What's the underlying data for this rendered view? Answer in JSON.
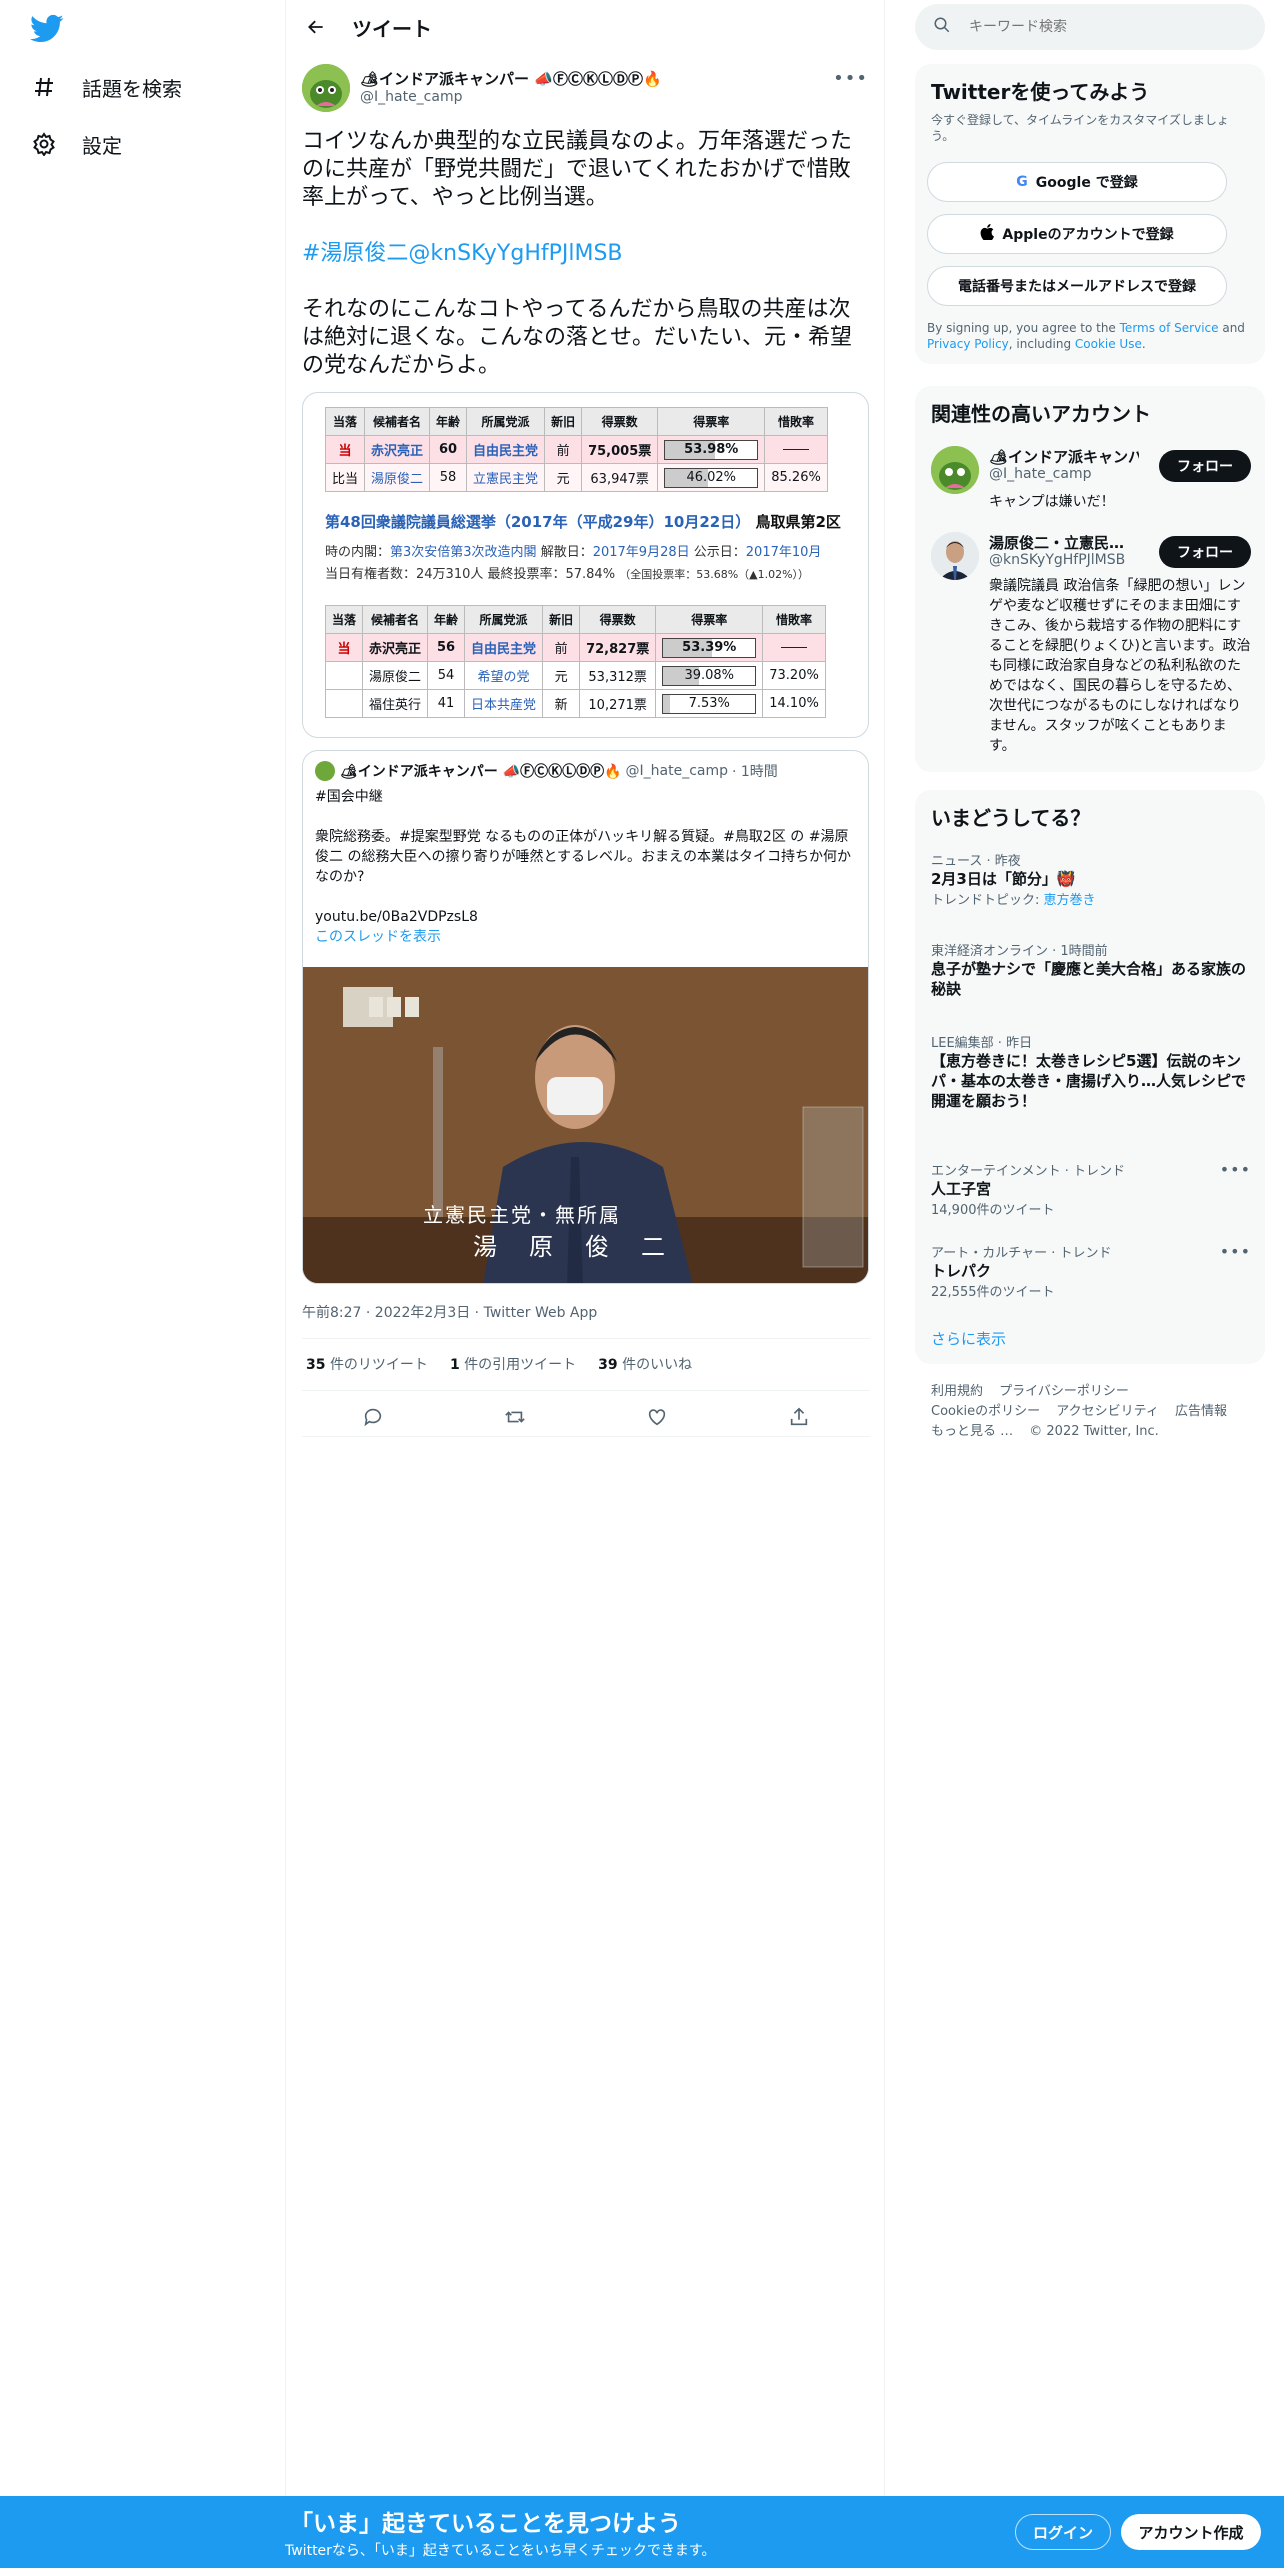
{
  "nav": {
    "explore_label": "話題を検索",
    "settings_label": "設定"
  },
  "header": {
    "title": "ツイート"
  },
  "tweet": {
    "author_name": "🏕インドア派キャンパー 📣ⒻⒸⓀⓁⒹⓅ🔥",
    "author_handle": "@I_hate_camp",
    "text_1": "コイツなんか典型的な立民議員なのよ。万年落選だったのに共産が「野党共闘だ」で退いてくれたおかげで惜敗率上がって、やっと比例当選。",
    "text_2": "#湯原俊二@knSKyYgHfPJlMSB",
    "text_3": "それなのにこんなコトやってるんだから鳥取の共産は次は絶対に退くな。こんなの落とせ。だいたい、元・希望の党なんだからよ。",
    "timestamp": "午前8:27 · 2022年2月3日 · Twitter Web App",
    "retweets_count": "35",
    "retweets_label": "件のリツイート",
    "quotes_count": "1",
    "quotes_label": "件の引用ツイート",
    "likes_count": "39",
    "likes_label": "件のいいね"
  },
  "election_image": {
    "headers": [
      "当落",
      "候補者名",
      "年齢",
      "所属党派",
      "新旧",
      "得票数",
      "得票率",
      "惜敗率"
    ],
    "table1": [
      {
        "result": "当",
        "name": "赤沢亮正",
        "age": "60",
        "party": "自由民主党",
        "status": "前",
        "votes": "75,005票",
        "rate": "53.98%",
        "rate_val": 53.98,
        "ratio": "――"
      },
      {
        "result": "比当",
        "name": "湯原俊二",
        "age": "58",
        "party": "立憲民主党",
        "status": "元",
        "votes": "63,947票",
        "rate": "46.02%",
        "rate_val": 46.02,
        "ratio": "85.26%"
      }
    ],
    "title": "第48回衆議院議員総選挙（2017年（平成29年）10月22日）",
    "district": "鳥取県第2区",
    "info1_label": "時の内閣：",
    "info1_cabinet": "第3次安倍第3次改造内閣",
    "info1_dissolve_label": "解散日：",
    "info1_dissolve": "2017年9月28日",
    "info1_announce_label": "公示日：",
    "info1_announce": "2017年10月",
    "info2": "当日有権者数：24万310人 最終投票率：57.84%",
    "info2_small": "（全国投票率：53.68%（▲1.02%））",
    "table2": [
      {
        "result": "当",
        "name": "赤沢亮正",
        "age": "56",
        "party": "自由民主党",
        "status": "前",
        "votes": "72,827票",
        "rate": "53.39%",
        "rate_val": 53.39,
        "ratio": "――"
      },
      {
        "result": "",
        "name": "湯原俊二",
        "age": "54",
        "party": "希望の党",
        "status": "元",
        "votes": "53,312票",
        "rate": "39.08%",
        "rate_val": 39.08,
        "ratio": "73.20%"
      },
      {
        "result": "",
        "name": "福住英行",
        "age": "41",
        "party": "日本共産党",
        "status": "新",
        "votes": "10,271票",
        "rate": "7.53%",
        "rate_val": 7.53,
        "ratio": "14.10%"
      }
    ]
  },
  "quote": {
    "author_name": "🏕インドア派キャンパー 📣ⒻⒸⓀⓁⒹⓅ🔥",
    "author_handle": "@I_hate_camp",
    "time": "· 1時間",
    "hashtag": "#国会中継",
    "text": "衆院総務委。#提案型野党 なるものの正体がハッキリ解る質疑。#鳥取2区 の #湯原俊二 の総務大臣への擦り寄りが唾然とするレベル。おまえの本業はタイコ持ちか何かなのか?",
    "link": "youtu.be/0Ba2VDPzsL8",
    "thread": "このスレッドを表示",
    "caption_party": "立憲民主党・無所属",
    "caption_name": "湯　原　俊　二"
  },
  "right": {
    "search_placeholder": "キーワード検索",
    "signup_title": "Twitterを使ってみよう",
    "signup_sub": "今すぐ登録して、タイムラインをカスタマイズしましょう。",
    "google_btn": "Google で登録",
    "apple_btn": "Appleのアカウントで登録",
    "phone_btn": "電話番号またはメールアドレスで登録",
    "terms_1": "By signing up, you agree to the ",
    "terms_tos": "Terms of Service",
    "terms_2": " and ",
    "terms_privacy": "Privacy Policy",
    "terms_3": ", including ",
    "terms_cookie": "Cookie Use",
    "terms_4": ".",
    "related_title": "関連性の高いアカウント",
    "related": [
      {
        "name": "🏕インドア派キャンパー…",
        "handle": "@I_hate_camp",
        "bio": "キャンプは嫌いだ！",
        "follow": "フォロー"
      },
      {
        "name": "湯原俊二・立憲民…",
        "handle": "@knSKyYgHfPJlMSB",
        "bio": "衆議院議員 政治信条「緑肥の想い」レンゲや麦など収穫せずにそのまま田畑にすきこみ、後から栽培する作物の肥料にすることを緑肥(りょくひ)と言います。政治も同様に政治家自身などの私利私欲のためではなく、国民の暮らしを守るため、次世代につながるものにしなければなりません。スタッフが呟くこともあります。",
        "follow": "フォロー"
      }
    ],
    "trends_title": "いまどうしてる？",
    "trends": [
      {
        "sub": "ニュース · 昨夜",
        "title": "2月3日は「節分」👹",
        "extra": "トレンドトピック: ",
        "extra_link": "恵方巻き"
      },
      {
        "sub": "東洋経済オンライン · 1時間前",
        "title": "息子が塾ナシで「慶應と美大合格」ある家族の秘訣"
      },
      {
        "sub": "LEE編集部 · 昨日",
        "title": "【恵方巻きに！太巻きレシピ5選】伝説のキンパ・基本の太巻き・唐揚げ入り…人気レシピで開運を願おう！"
      },
      {
        "sub": "エンターテインメント · トレンド",
        "title": "人工子宮",
        "extra": "14,900件のツイート"
      },
      {
        "sub": "アート・カルチャー · トレンド",
        "title": "トレパク",
        "extra": "22,555件のツイート"
      }
    ],
    "show_more": "さらに表示",
    "footer": [
      "利用規約",
      "プライバシーポリシー",
      "Cookieのポリシー",
      "アクセシビリティ",
      "広告情報",
      "もっと見る …",
      "© 2022 Twitter, Inc."
    ]
  },
  "bottombar": {
    "headline": "「いま」起きていることを見つけよう",
    "sub": "Twitterなら、「いま」起きていることをいち早くチェックできます。",
    "login": "ログイン",
    "signup": "アカウント作成"
  },
  "colors": {
    "accent": "#1d9bf0",
    "text": "#0f1419",
    "muted": "#536471",
    "bar": "#1d9bf0"
  }
}
